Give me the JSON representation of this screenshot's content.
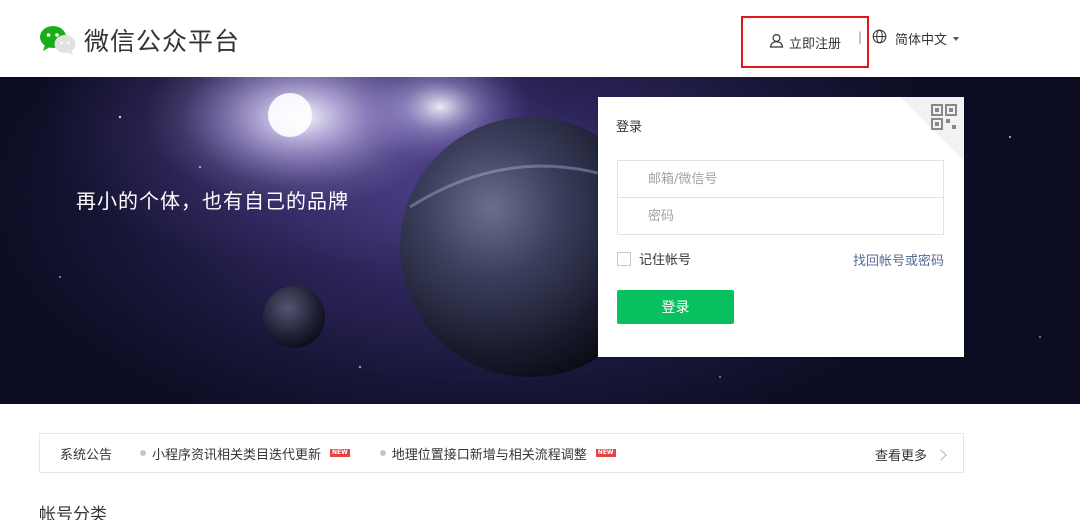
{
  "header": {
    "logo_text": "微信公众平台",
    "register_label": "立即注册",
    "separator": "|",
    "language_label": "简体中文"
  },
  "banner": {
    "slogan": "再小的个体，也有自己的品牌"
  },
  "login": {
    "title": "登录",
    "account_placeholder": "邮箱/微信号",
    "password_placeholder": "密码",
    "remember_label": "记住帐号",
    "forgot_label": "找回帐号或密码",
    "submit_label": "登录"
  },
  "notice": {
    "label": "系统公告",
    "items": [
      {
        "text": "小程序资讯相关类目迭代更新",
        "badge": "NEW"
      },
      {
        "text": "地理位置接口新增与相关流程调整",
        "badge": "NEW"
      }
    ],
    "more_label": "查看更多"
  },
  "section": {
    "title": "帐号分类"
  },
  "colors": {
    "brand_green": "#07c160",
    "link_blue": "#576b95",
    "highlight_red": "#e0161a",
    "badge_red": "#e64340"
  }
}
